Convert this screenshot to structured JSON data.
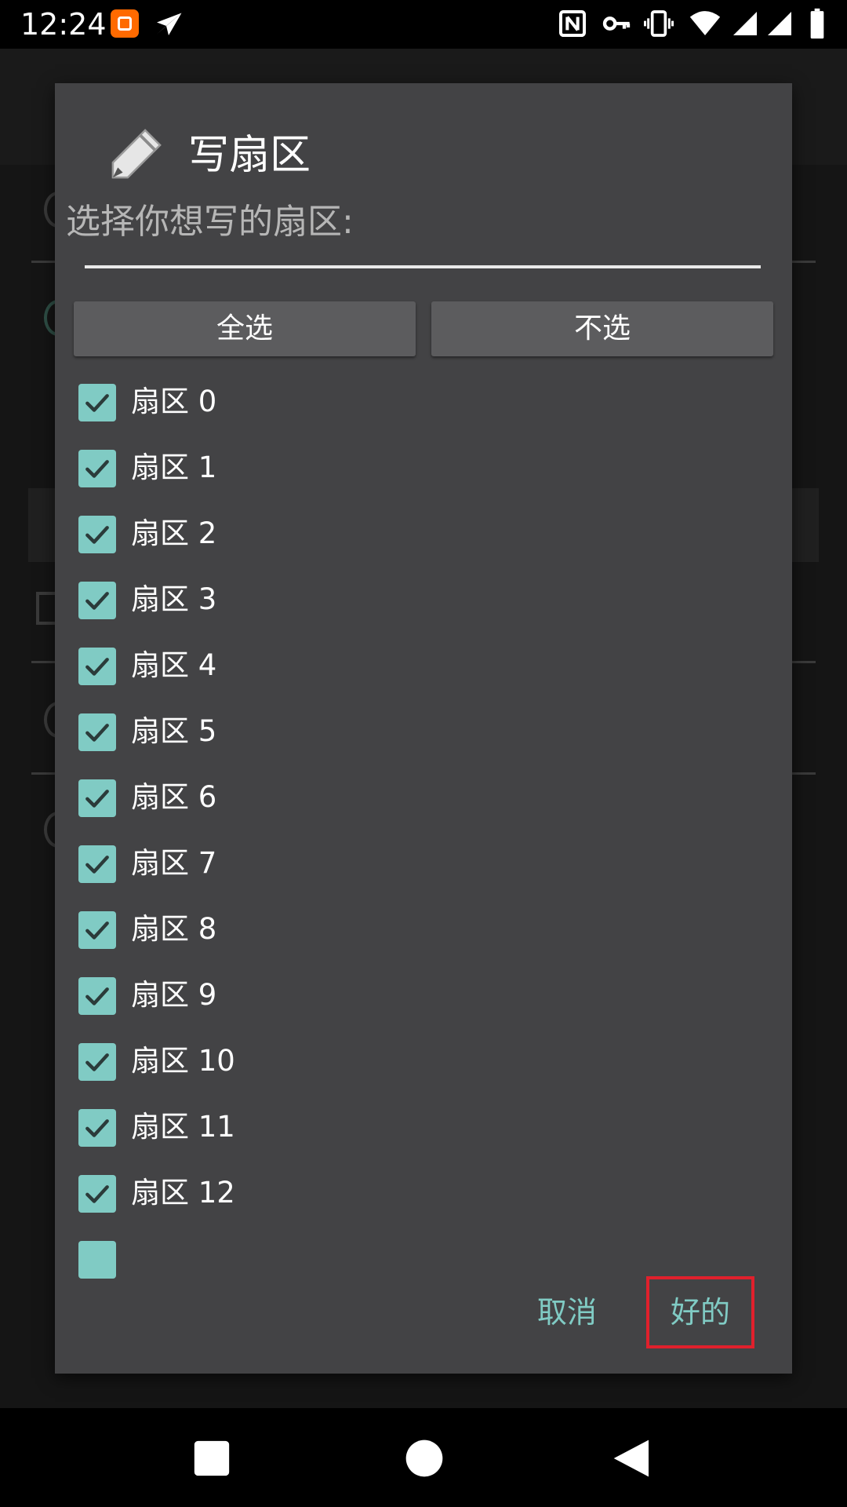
{
  "status_bar": {
    "time": "12:24",
    "icons": [
      "mi-app-icon",
      "send-icon",
      "nfc-icon",
      "vpn-key-icon",
      "vibrate-icon",
      "wifi-icon",
      "signal-icon",
      "signal-icon",
      "battery-icon"
    ]
  },
  "dialog": {
    "icon": "pencil-icon",
    "title": "写扇区",
    "prompt": "选择你想写的扇区:",
    "select_all_label": "全选",
    "select_none_label": "不选",
    "sectors": [
      {
        "label": "扇区 0",
        "checked": true
      },
      {
        "label": "扇区 1",
        "checked": true
      },
      {
        "label": "扇区 2",
        "checked": true
      },
      {
        "label": "扇区 3",
        "checked": true
      },
      {
        "label": "扇区 4",
        "checked": true
      },
      {
        "label": "扇区 5",
        "checked": true
      },
      {
        "label": "扇区 6",
        "checked": true
      },
      {
        "label": "扇区 7",
        "checked": true
      },
      {
        "label": "扇区 8",
        "checked": true
      },
      {
        "label": "扇区 9",
        "checked": true
      },
      {
        "label": "扇区 10",
        "checked": true
      },
      {
        "label": "扇区 11",
        "checked": true
      },
      {
        "label": "扇区 12",
        "checked": true
      }
    ],
    "cancel_label": "取消",
    "ok_label": "好的"
  },
  "colors": {
    "accent": "#80cbc4",
    "dialog_bg": "#434345",
    "highlight_box": "#e0202c"
  },
  "nav_bar": {
    "icons": [
      "recents-square-icon",
      "home-circle-icon",
      "back-triangle-icon"
    ]
  }
}
